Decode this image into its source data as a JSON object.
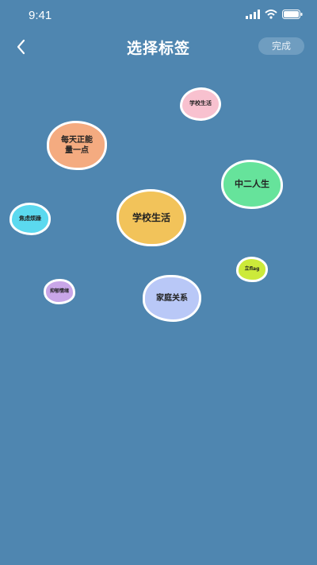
{
  "status_bar": {
    "time": "9:41"
  },
  "nav": {
    "title": "选择标签",
    "done_label": "完成"
  },
  "tags": [
    {
      "label": "学校生活",
      "color": "#f8c1cf"
    },
    {
      "label": "每天正能\n量一点",
      "color": "#f4ab80"
    },
    {
      "label": "中二人生",
      "color": "#66e39b"
    },
    {
      "label": "焦虑烦躁",
      "color": "#5bd9ef"
    },
    {
      "label": "学校生活",
      "color": "#f2c35a"
    },
    {
      "label": "立flag",
      "color": "#ccea3a"
    },
    {
      "label": "抑郁情绪",
      "color": "#c9a6e8"
    },
    {
      "label": "家庭关系",
      "color": "#b9c8f7"
    }
  ]
}
